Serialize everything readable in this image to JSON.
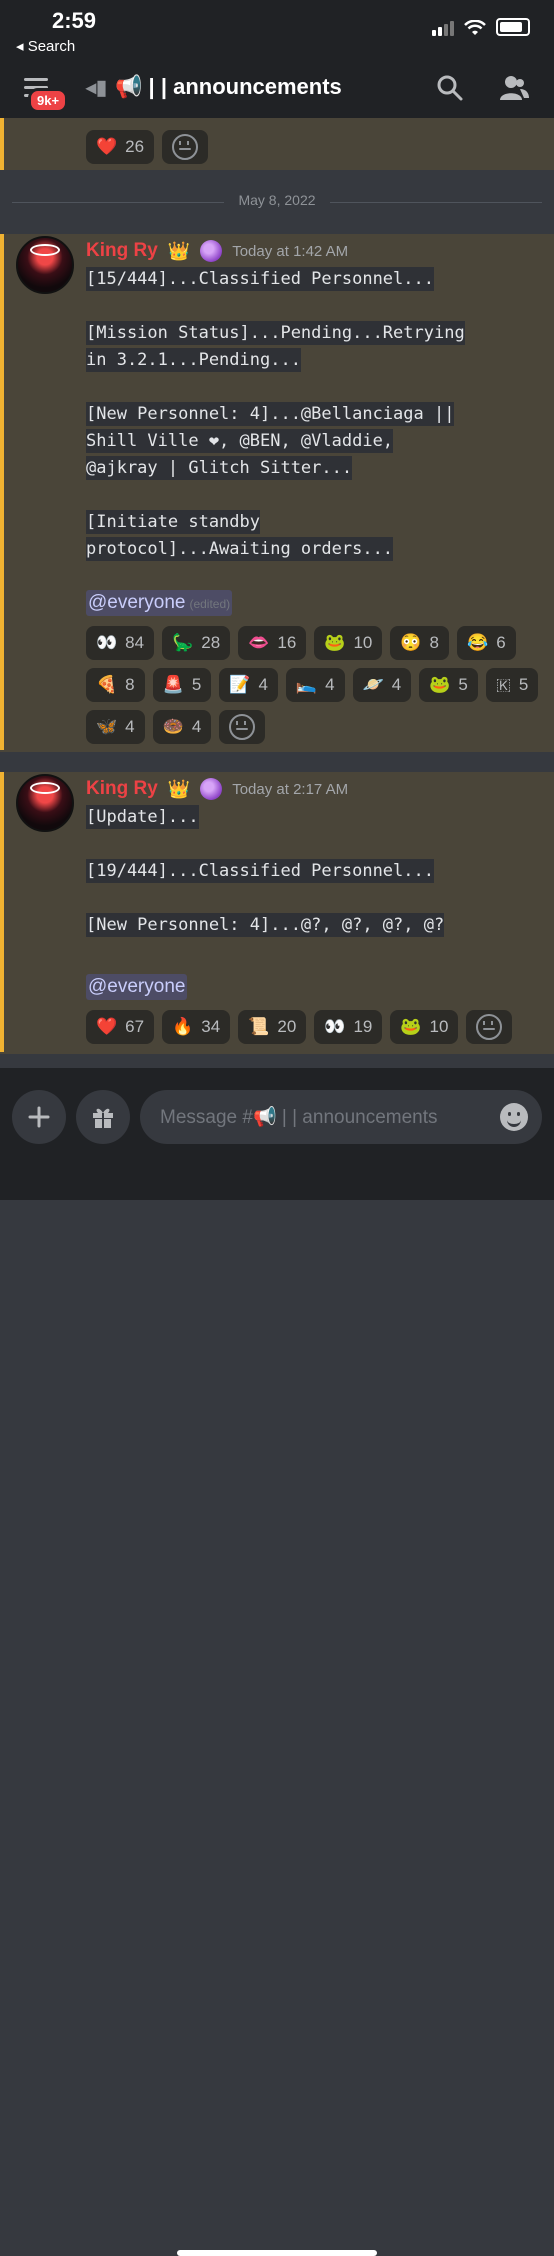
{
  "status_bar": {
    "time": "2:59",
    "back": "◂ Search"
  },
  "header": {
    "badge": "9k+",
    "channel_title": "📢 | | announcements"
  },
  "top_reactions": [
    {
      "emoji": "❤️",
      "count": "26"
    }
  ],
  "date_separator": "May 8, 2022",
  "messages": [
    {
      "author": "King Ry",
      "crown": "👑",
      "timestamp": "Today at 1:42 AM",
      "lines": [
        "[15/444]...Classified Personnel...",
        "",
        "[Mission Status]...Pending...Retrying",
        "in 3.2.1...Pending...",
        "",
        "[New Personnel: 4]...@Bellanciaga ||",
        "Shill Ville ❤, @BEN, @Vladdie,",
        "@ajkray | Glitch Sitter...",
        "",
        "[Initiate standby",
        "protocol]...Awaiting orders..."
      ],
      "mention": "@everyone",
      "edited": "(edited)",
      "reactions": [
        {
          "emoji": "👀",
          "count": "84"
        },
        {
          "emoji": "🦕",
          "count": "28"
        },
        {
          "emoji": "👄",
          "count": "16"
        },
        {
          "emoji": "🐸",
          "count": "10"
        },
        {
          "emoji": "😳",
          "count": "8"
        },
        {
          "emoji": "😂",
          "count": "6"
        },
        {
          "emoji": "🍕",
          "count": "8"
        },
        {
          "emoji": "🚨",
          "count": "5"
        },
        {
          "emoji": "📝",
          "count": "4"
        },
        {
          "emoji": "🛌",
          "count": "4"
        },
        {
          "emoji": "🪐",
          "count": "4"
        },
        {
          "emoji": "🐸",
          "count": "5"
        },
        {
          "emoji": "🇰",
          "count": "5"
        },
        {
          "emoji": "🦋",
          "count": "4"
        },
        {
          "emoji": "🍩",
          "count": "4"
        }
      ]
    },
    {
      "author": "King Ry",
      "crown": "👑",
      "timestamp": "Today at 2:17 AM",
      "lines": [
        "[Update]...",
        "",
        "[19/444]...Classified Personnel...",
        "",
        "[New Personnel: 4]...@?, @?, @?, @?"
      ],
      "mention": "@everyone",
      "reactions": [
        {
          "emoji": "❤️",
          "count": "67"
        },
        {
          "emoji": "🔥",
          "count": "34"
        },
        {
          "emoji": "📜",
          "count": "20"
        },
        {
          "emoji": "👀",
          "count": "19"
        },
        {
          "emoji": "🐸",
          "count": "10"
        }
      ]
    }
  ],
  "composer": {
    "placeholder": "Message #📢 | | announcements"
  }
}
